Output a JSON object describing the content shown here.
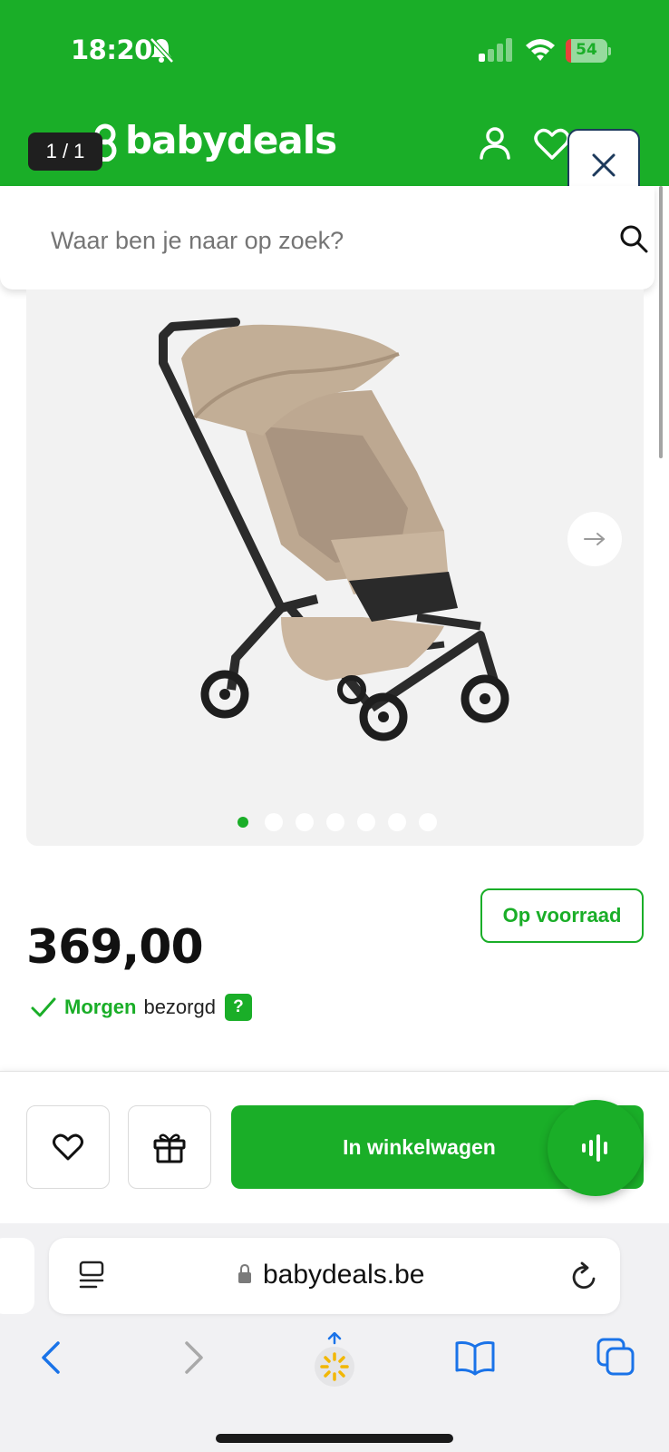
{
  "status_bar": {
    "time": "18:20",
    "battery": "54"
  },
  "header": {
    "logo_text": "babydeals",
    "page_counter": "1 / 1",
    "close_icon": "close-icon"
  },
  "search": {
    "placeholder": "Waar ben je naar op zoek?"
  },
  "gallery": {
    "dot_count": 7,
    "active_index": 0
  },
  "product": {
    "stock_label": "Op voorraad",
    "price": "369,00",
    "delivery_day": "Morgen",
    "delivery_text": "bezorgd",
    "help": "?"
  },
  "buy_bar": {
    "cart_label": "In winkelwagen"
  },
  "browser": {
    "url": "babydeals.be"
  },
  "colors": {
    "brand_green": "#1aae28",
    "close_border": "#1d3a5c",
    "safari_blue": "#1a73e8"
  }
}
